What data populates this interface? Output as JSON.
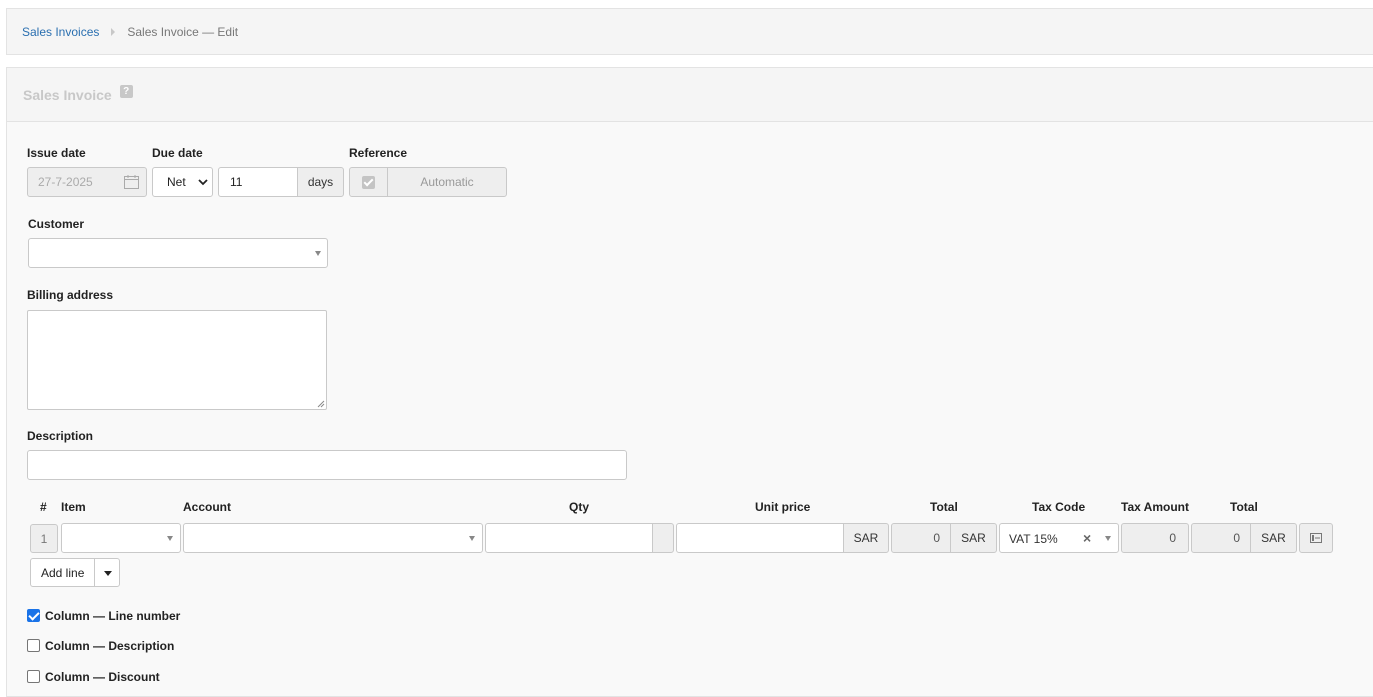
{
  "breadcrumb": {
    "parent": "Sales Invoices",
    "current": "Sales Invoice — Edit"
  },
  "header": {
    "title": "Sales Invoice",
    "help": "?"
  },
  "form": {
    "issue_date": {
      "label": "Issue date",
      "value": "27-7-2025"
    },
    "due_date": {
      "label": "Due date",
      "mode": "Net",
      "value": "11",
      "unit": "days"
    },
    "reference": {
      "label": "Reference",
      "value": "Automatic"
    },
    "customer": {
      "label": "Customer",
      "value": ""
    },
    "billing_address": {
      "label": "Billing address",
      "value": ""
    },
    "description": {
      "label": "Description",
      "value": ""
    }
  },
  "lines": {
    "headers": {
      "num": "#",
      "item": "Item",
      "account": "Account",
      "qty": "Qty",
      "unit_price": "Unit price",
      "total": "Total",
      "tax_code": "Tax Code",
      "tax_amount": "Tax Amount",
      "total2": "Total"
    },
    "rows": [
      {
        "num": "1",
        "item": "",
        "account": "",
        "qty": "",
        "unit_price": "",
        "currency": "SAR",
        "total": "0",
        "total_currency": "SAR",
        "tax_code": "VAT 15%",
        "tax_amount": "0",
        "total2": "0",
        "total2_currency": "SAR"
      }
    ],
    "add_line": "Add line"
  },
  "columns": [
    {
      "label": "Column — Line number",
      "checked": true
    },
    {
      "label": "Column — Description",
      "checked": false
    },
    {
      "label": "Column — Discount",
      "checked": false
    }
  ],
  "colors": {
    "link": "#2a6fb0",
    "checkbox": "#1a73e8",
    "panel_bg": "#f9f9f9"
  }
}
